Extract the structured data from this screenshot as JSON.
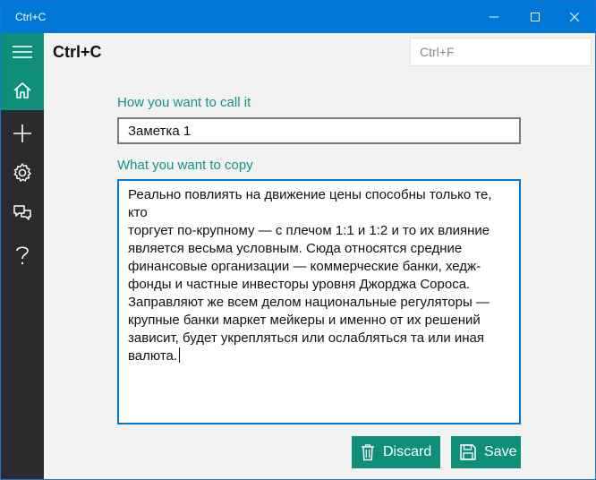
{
  "window": {
    "title": "Ctrl+C"
  },
  "topbar": {
    "app_title": "Ctrl+C",
    "search_placeholder": "Ctrl+F"
  },
  "sidebar": {
    "items": [
      {
        "name": "menu",
        "icon": "hamburger-icon"
      },
      {
        "name": "home",
        "icon": "home-icon",
        "active": true
      },
      {
        "name": "add",
        "icon": "plus-icon"
      },
      {
        "name": "settings",
        "icon": "gear-icon"
      },
      {
        "name": "snippets",
        "icon": "chat-icon"
      },
      {
        "name": "help",
        "icon": "question-icon"
      }
    ]
  },
  "form": {
    "name_label": "How you want to call it",
    "name_value": "Заметка 1",
    "copy_label": "What you want to copy",
    "copy_value": "Реально повлиять на движение цены способны только те, кто\nторгует по-крупному — с плечом 1:1 и 1:2 и то их влияние\nявляется весьма условным. Сюда относятся средние\nфинансовые организации — коммерческие банки, хедж-\nфонды и частные инвесторы уровня Джорджа Сороса.\nЗаправляют же всем делом национальные регуляторы —\nкрупные банки маркет мейкеры и именно от их решений\nзависит, будет укрепляться или ослабляться та или иная\nвалюта."
  },
  "actions": {
    "discard_label": "Discard",
    "save_label": "Save"
  },
  "colors": {
    "titlebar": "#0078d7",
    "accent": "#0f8f78",
    "label": "#0f9488",
    "sidebar": "#2b2b2b"
  }
}
